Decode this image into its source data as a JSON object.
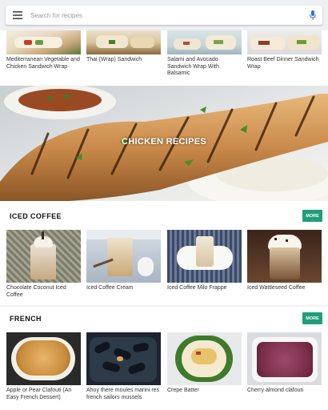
{
  "search": {
    "placeholder": "Search for recipes"
  },
  "top_row": [
    {
      "title": "Mediterranean Vegetable and Chicken Sandwich Wrap"
    },
    {
      "title": "Thai (Wrap) Sandwich"
    },
    {
      "title": "Salami and Avocado Sandwich Wrap With Balsamic"
    },
    {
      "title": "Roast Beef Dinner Sandwich Wrap"
    }
  ],
  "hero": {
    "title": "CHICKEN RECIPES"
  },
  "sections": [
    {
      "title": "ICED COFFEE",
      "more_label": "MORE",
      "items": [
        {
          "title": "Chocolate Coconut Iced Coffee"
        },
        {
          "title": "Iced Coffee Cream"
        },
        {
          "title": "Iced Coffee Milo Frappe"
        },
        {
          "title": "Iced Wattleseed Coffee"
        }
      ]
    },
    {
      "title": "FRENCH",
      "more_label": "MORE",
      "items": [
        {
          "title": "Apple or Pear Clafouti (An Easy French Dessert)"
        },
        {
          "title": "Ahoy there moules marini res french sailors mussels"
        },
        {
          "title": "Crepe Batter"
        },
        {
          "title": "Cherry almond clafouti"
        }
      ]
    }
  ],
  "icons": {
    "menu": "menu-icon",
    "mic": "mic-icon"
  },
  "colors": {
    "accent": "#1f9e7a",
    "mic": "#3b6fd8"
  }
}
